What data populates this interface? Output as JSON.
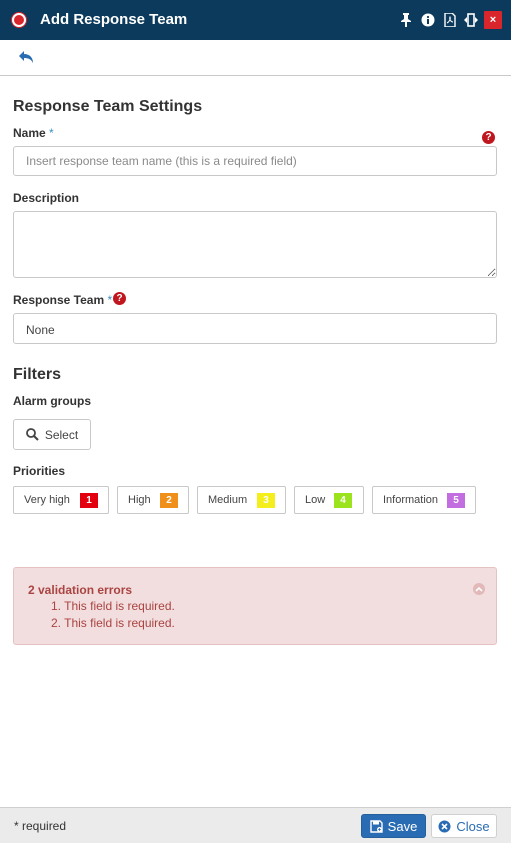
{
  "window": {
    "title": "Add Response Team",
    "icons": [
      "record-dot-icon",
      "pin-icon",
      "info-icon",
      "pdf-icon",
      "resize-icon",
      "close-icon"
    ],
    "close_label": "×"
  },
  "toolbar": {
    "back_icon": "reply-arrow-icon"
  },
  "settings": {
    "heading": "Response Team Settings",
    "name_label": "Name",
    "required_star": "*",
    "name_placeholder": "Insert response team name (this is a required field)",
    "name_value": "",
    "description_label": "Description",
    "description_value": "",
    "response_team_label": "Response Team",
    "response_team_value": "None",
    "help_glyph": "?"
  },
  "filters": {
    "heading": "Filters",
    "alarm_groups_label": "Alarm groups",
    "select_button": "Select",
    "priorities_label": "Priorities",
    "priorities": [
      {
        "label": "Very high",
        "number": "1",
        "color": "#e3000f"
      },
      {
        "label": "High",
        "number": "2",
        "color": "#f0901a"
      },
      {
        "label": "Medium",
        "number": "3",
        "color": "#f4ef1c"
      },
      {
        "label": "Low",
        "number": "4",
        "color": "#9be31d"
      },
      {
        "label": "Information",
        "number": "5",
        "color": "#c26de0"
      }
    ]
  },
  "validation": {
    "title": "2 validation errors",
    "errors": [
      "1. This field is required.",
      "2. This field is required."
    ]
  },
  "footer": {
    "required_note": "* required",
    "save_label": "Save",
    "close_label": "Close"
  },
  "colors": {
    "titlebar": "#0b3a5c",
    "accent": "#2a6cb3",
    "error_bg": "#f2dede",
    "error_text": "#a94442"
  }
}
